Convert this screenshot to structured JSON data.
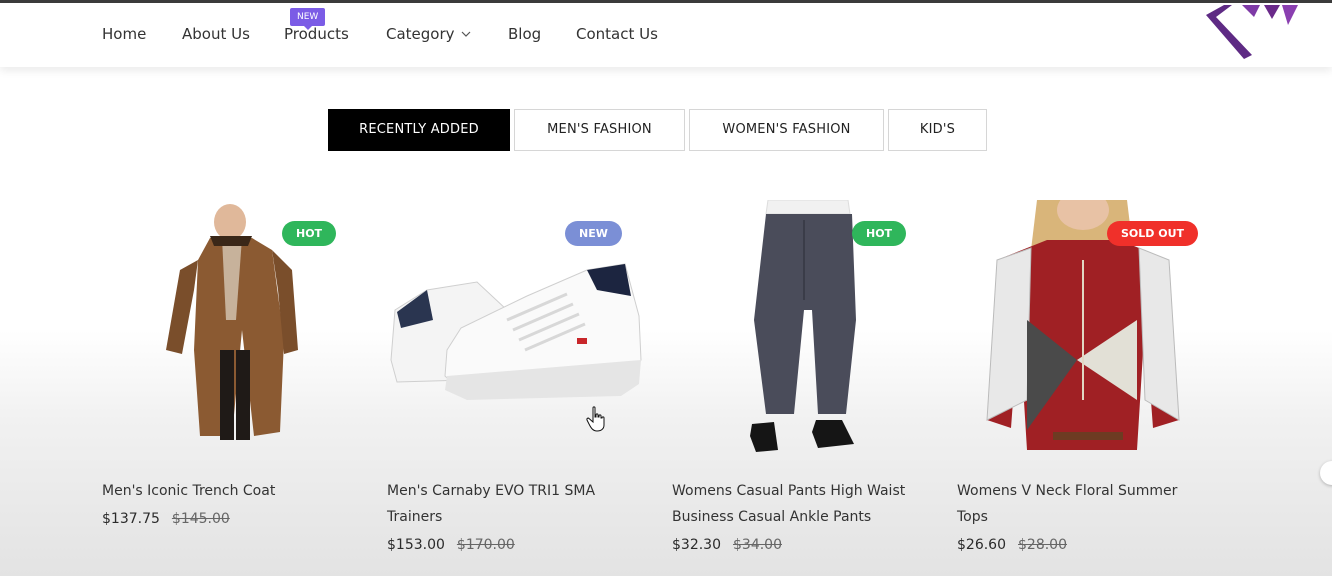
{
  "nav": {
    "items": [
      {
        "label": "Home"
      },
      {
        "label": "About Us"
      },
      {
        "label": "Products"
      },
      {
        "label": "Category"
      },
      {
        "label": "Blog"
      },
      {
        "label": "Contact Us"
      }
    ],
    "new_badge": "NEW"
  },
  "tabs": [
    {
      "label": "RECENTLY ADDED",
      "active": true
    },
    {
      "label": "MEN'S FASHION",
      "active": false
    },
    {
      "label": "WOMEN'S FASHION",
      "active": false
    },
    {
      "label": "KID'S",
      "active": false
    }
  ],
  "products": [
    {
      "title": "Men's Iconic Trench Coat",
      "price": "$137.75",
      "old_price": "$145.00",
      "badge": "HOT",
      "badge_color": "#2fb65b"
    },
    {
      "title": "Men's Carnaby EVO TRI1 SMA Trainers",
      "price": "$153.00",
      "old_price": "$170.00",
      "badge": "NEW",
      "badge_color": "#7b8fd6"
    },
    {
      "title": "Womens Casual Pants High Waist Business Casual Ankle Pants",
      "price": "$32.30",
      "old_price": "$34.00",
      "badge": "HOT",
      "badge_color": "#2fb65b"
    },
    {
      "title": "Womens V Neck Floral Summer Tops",
      "price": "$26.60",
      "old_price": "$28.00",
      "badge": "SOLD OUT",
      "badge_color": "#f0302a"
    }
  ],
  "colors": {
    "brand_purple": "#6a2a8a",
    "accent_new": "#7b5ce6"
  }
}
